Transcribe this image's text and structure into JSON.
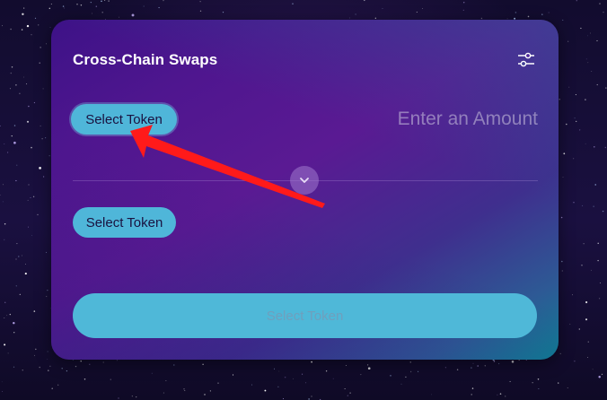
{
  "swap_card": {
    "title": "Cross-Chain Swaps",
    "settings_icon": "sliders-icon",
    "from_token_label": "Select Token",
    "amount_placeholder": "Enter an Amount",
    "switch_icon": "chevron-down-icon",
    "to_token_label": "Select Token",
    "submit_label": "Select Token"
  },
  "annotation": {
    "arrow_icon": "red-arrow-icon",
    "arrow_color": "#ff1a1a"
  },
  "colors": {
    "token_button": "#4fb6d9",
    "card_start": "#3d1287",
    "card_end": "#0e7f94"
  }
}
